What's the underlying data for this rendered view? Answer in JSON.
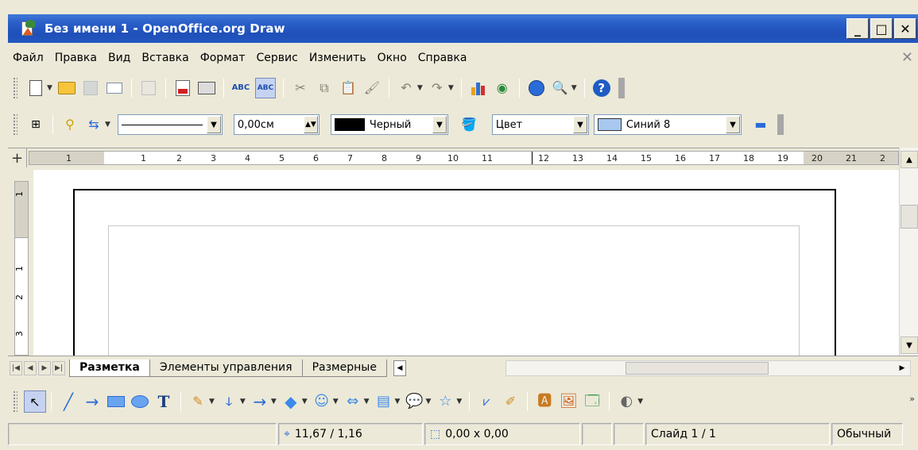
{
  "window": {
    "title": "Без имени 1 - OpenOffice.org Draw",
    "minimize": "_",
    "maximize": "□",
    "close": "✕"
  },
  "menu": {
    "items": [
      "Файл",
      "Правка",
      "Вид",
      "Вставка",
      "Формат",
      "Сервис",
      "Изменить",
      "Окно",
      "Справка"
    ],
    "close_doc": "✕"
  },
  "standard_toolbar": {
    "icons": [
      "new-icon",
      "open-icon",
      "save-icon",
      "email-icon",
      "edit-file-icon",
      "export-pdf-icon",
      "print-icon",
      "spellcheck-icon",
      "autospellcheck-icon",
      "cut-icon",
      "copy-icon",
      "paste-icon",
      "format-paintbrush-icon",
      "undo-icon",
      "redo-icon",
      "chart-icon",
      "gallery-icon",
      "navigator-icon",
      "zoom-icon",
      "help-icon"
    ]
  },
  "line_fill_toolbar": {
    "line_width": "0,00см",
    "line_color": "Черный",
    "line_color_hex": "#000000",
    "area_style": "Цвет",
    "fill_color": "Синий 8",
    "fill_color_hex": "#a8c8f0"
  },
  "ruler": {
    "corner": "+",
    "h_labels": [
      "1",
      "1",
      "2",
      "3",
      "4",
      "5",
      "6",
      "7",
      "8",
      "9",
      "10",
      "11",
      "12",
      "13",
      "14",
      "15",
      "16",
      "17",
      "18",
      "19",
      "20",
      "21",
      "2"
    ],
    "v_labels": [
      "1",
      "1",
      "2",
      "3"
    ]
  },
  "tabs": {
    "items": [
      "Разметка",
      "Элементы управления",
      "Размерные"
    ],
    "active": "Разметка"
  },
  "status": {
    "position": "11,67 / 1,16",
    "size": "0,00 x 0,00",
    "slide": "Слайд 1 / 1",
    "layout": "Обычный"
  }
}
